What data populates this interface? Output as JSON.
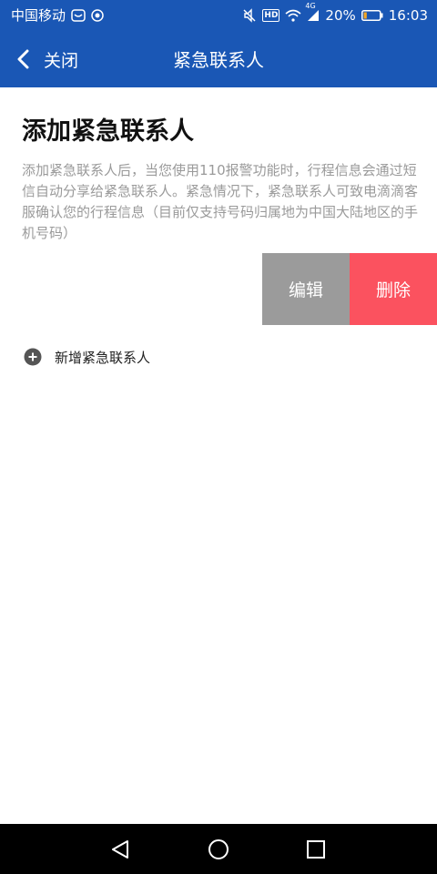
{
  "status_bar": {
    "carrier": "中国移动",
    "hd_badge": "HD",
    "network_type": "4G",
    "battery_percent": "20%",
    "battery_level": 0.2,
    "time": "16:03",
    "icons": [
      "app-notification-icon",
      "shield-app-icon",
      "mute-icon",
      "hd-icon",
      "wifi-icon",
      "signal-icon",
      "battery-icon"
    ]
  },
  "nav": {
    "back_label": "关闭",
    "title": "紧急联系人"
  },
  "page": {
    "title": "添加紧急联系人",
    "description": "添加紧急联系人后，当您使用110报警功能时，行程信息会通过短信自动分享给紧急联系人。紧急情况下，紧急联系人可致电滴滴客服确认您的行程信息（目前仅支持号码归属地为中国大陆地区的手机号码）"
  },
  "contact_actions": {
    "edit_label": "编辑",
    "delete_label": "删除"
  },
  "add_contact": {
    "label": "新增紧急联系人"
  },
  "colors": {
    "primary": "#1a57b5",
    "edit_bg": "#9b9b9b",
    "delete_bg": "#fb525f",
    "description_text": "#9a9a9a"
  }
}
